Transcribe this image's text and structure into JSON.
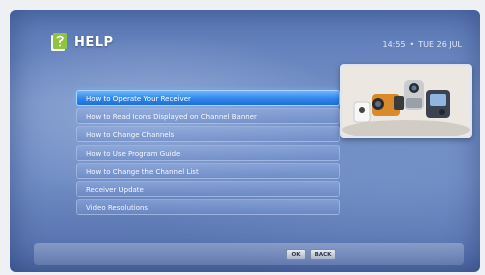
{
  "header": {
    "title": "HELP",
    "time": "14:55",
    "separator": "•",
    "date": "TUE 26 JUL",
    "icon": "help-book-icon"
  },
  "menu": {
    "selected_index": 0,
    "items": [
      {
        "label": "How to Operate Your Receiver"
      },
      {
        "label": "How to Read Icons Displayed on Channel Banner"
      },
      {
        "label": "How to Change Channels"
      },
      {
        "label": "How to Use Program Guide"
      },
      {
        "label": "How to Change the Channel List"
      },
      {
        "label": "Receiver Update"
      },
      {
        "label": "Video Resolutions"
      }
    ]
  },
  "preview": {
    "description_icon": "camcorder-preview-image"
  },
  "footer": {
    "ok_label": "OK",
    "back_label": "BACK"
  },
  "colors": {
    "highlight": "#2f86ea",
    "background": "#6f8cc4",
    "text": "#f4f7ff"
  }
}
